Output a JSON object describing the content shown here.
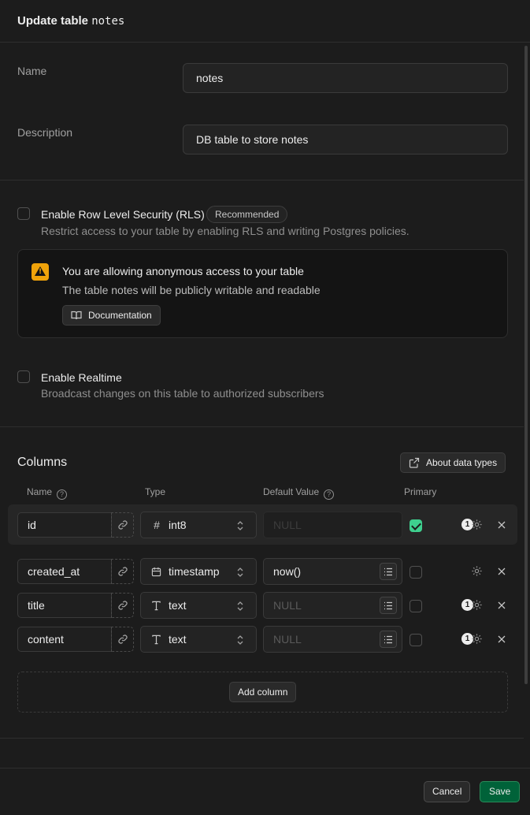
{
  "header": {
    "title_prefix": "Update table",
    "table_name": "notes"
  },
  "form": {
    "name_label": "Name",
    "name_value": "notes",
    "description_label": "Description",
    "description_value": "DB table to store notes"
  },
  "rls": {
    "title": "Enable Row Level Security (RLS)",
    "badge": "Recommended",
    "description": "Restrict access to your table by enabling RLS and writing Postgres policies.",
    "checked": false
  },
  "alert": {
    "icon": "warning-icon",
    "title": "You are allowing anonymous access to your table",
    "description": "The table notes will be publicly writable and readable",
    "doc_button": "Documentation"
  },
  "realtime": {
    "title": "Enable Realtime",
    "description": "Broadcast changes on this table to authorized subscribers",
    "checked": false
  },
  "columns": {
    "title": "Columns",
    "about_button": "About data types",
    "headers": {
      "name": "Name",
      "type": "Type",
      "default": "Default Value",
      "primary": "Primary"
    },
    "rows": [
      {
        "name": "id",
        "type": "int8",
        "type_icon": "#",
        "default": "NULL",
        "primary": true,
        "badge": "1"
      },
      {
        "name": "created_at",
        "type": "timestamp",
        "type_icon": "calendar",
        "default": "now()",
        "primary": false,
        "badge": ""
      },
      {
        "name": "title",
        "type": "text",
        "type_icon": "T",
        "default": "NULL",
        "primary": false,
        "badge": "1"
      },
      {
        "name": "content",
        "type": "text",
        "type_icon": "T",
        "default": "NULL",
        "primary": false,
        "badge": "1"
      }
    ],
    "add_button": "Add column"
  },
  "footer": {
    "cancel": "Cancel",
    "save": "Save"
  },
  "colors": {
    "accent": "#3ecf8e",
    "save_bg": "#006239",
    "warning": "#f0a30a"
  }
}
